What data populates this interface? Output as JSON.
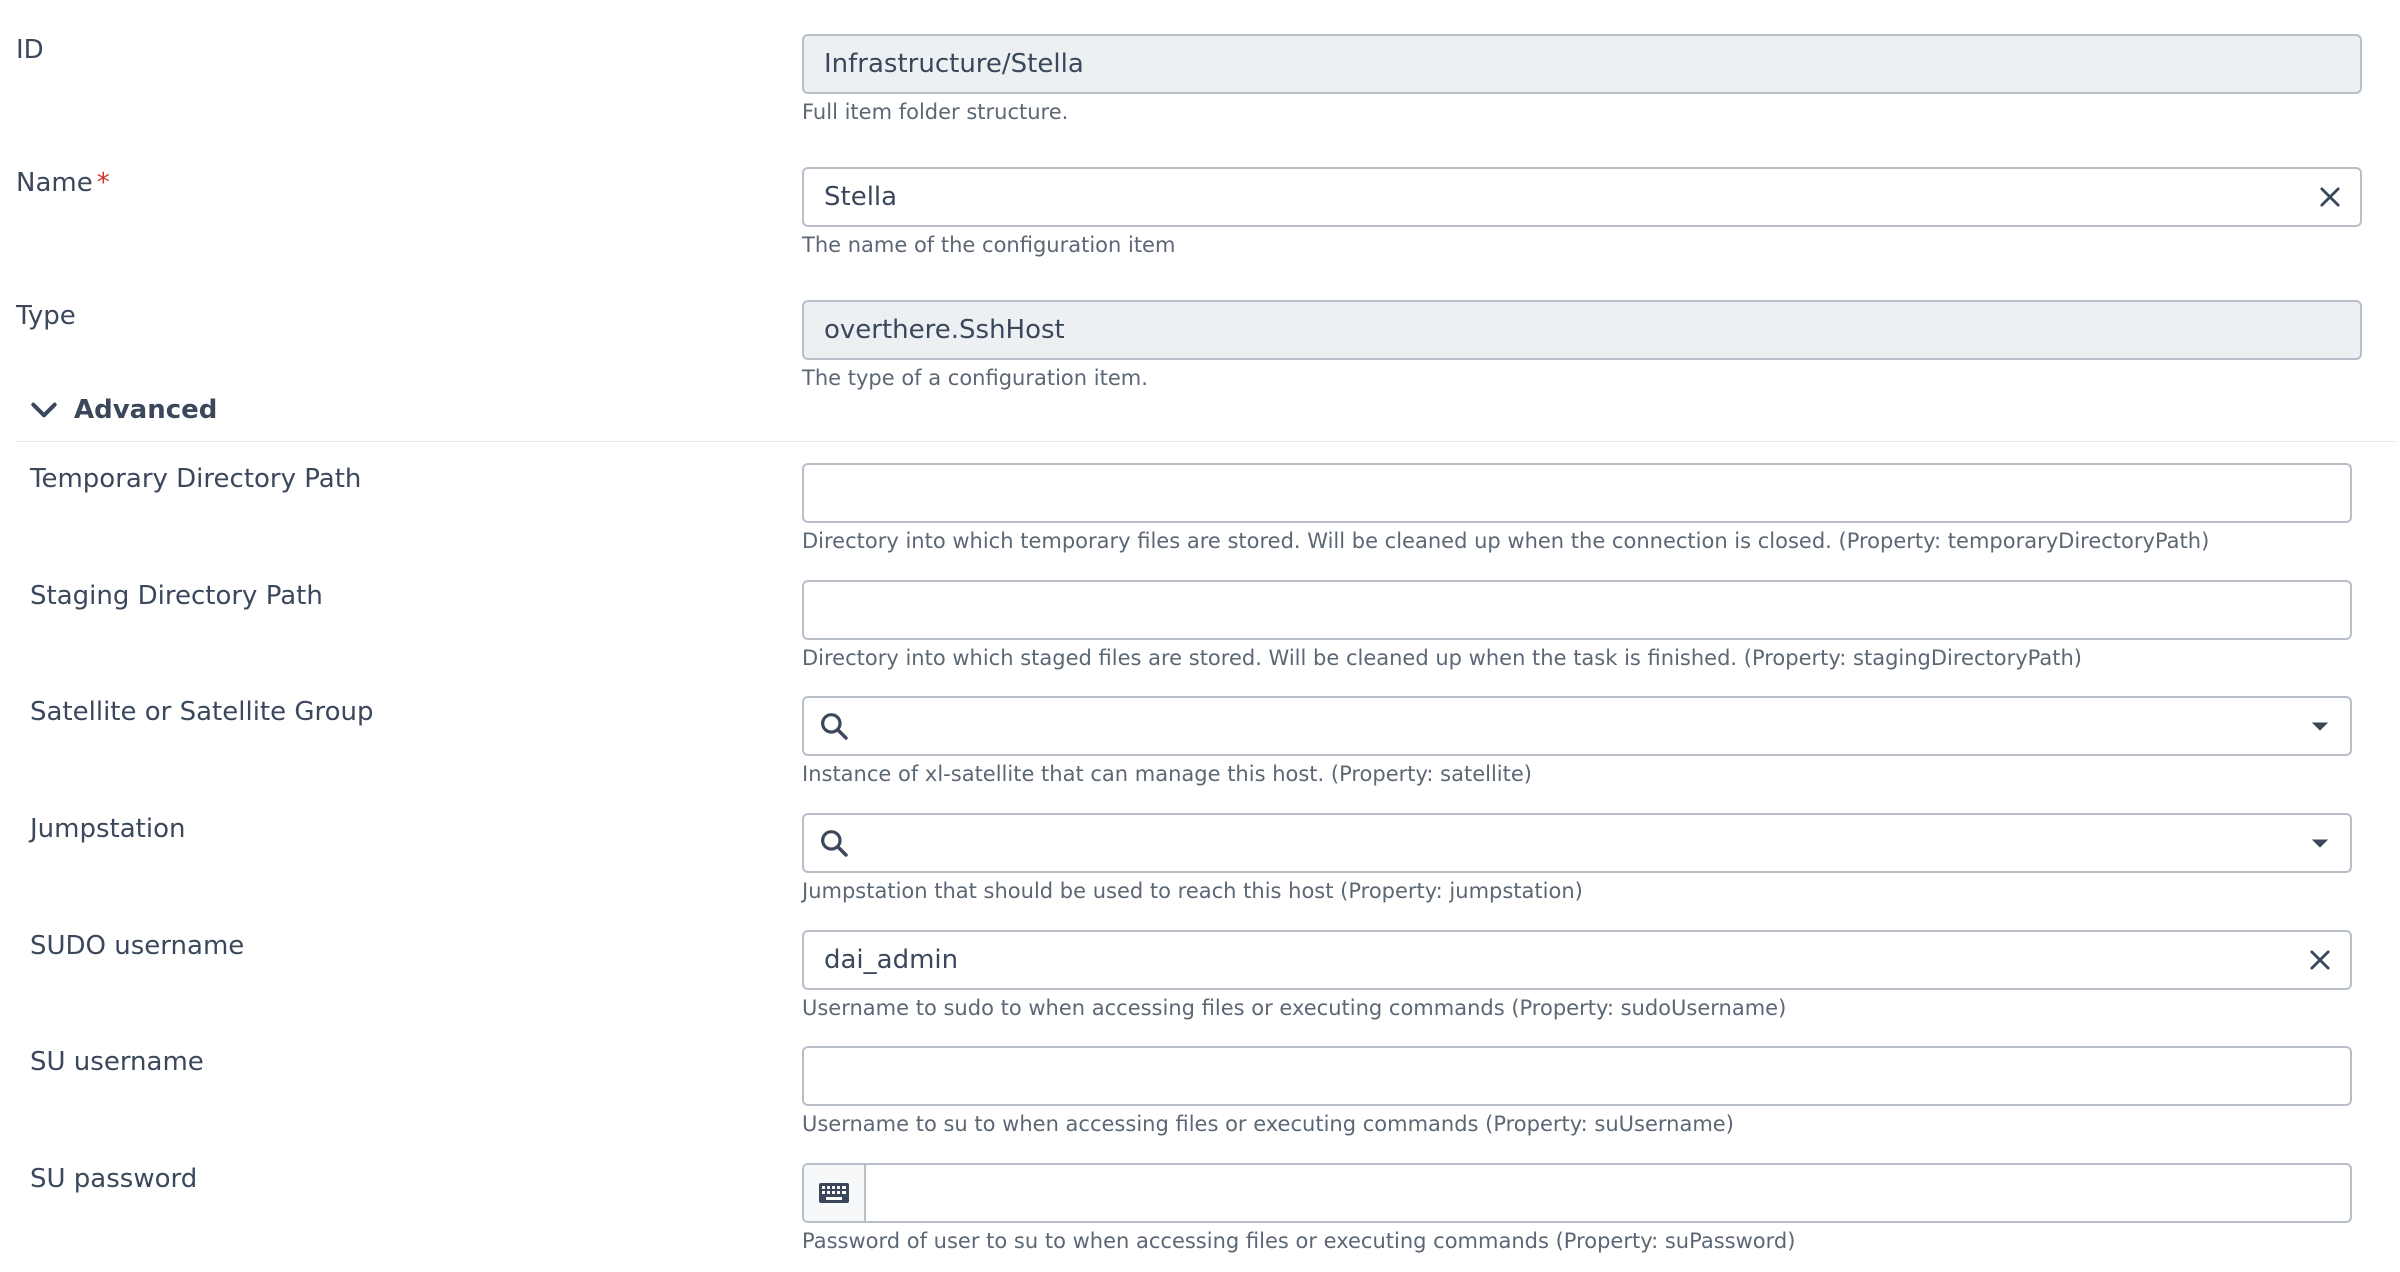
{
  "basic": {
    "id": {
      "label": "ID",
      "value": "Infrastructure/Stella",
      "helper": "Full item folder structure."
    },
    "name": {
      "label": "Name",
      "required_mark": "*",
      "value": "Stella",
      "helper": "The name of the configuration item"
    },
    "type": {
      "label": "Type",
      "value": "overthere.SshHost",
      "helper": "The type of a configuration item."
    }
  },
  "advanced": {
    "title": "Advanced",
    "expanded": true,
    "fields": {
      "temporary_directory_path": {
        "label": "Temporary Directory Path",
        "value": "",
        "helper": "Directory into which temporary files are stored. Will be cleaned up when the connection is closed. (Property: temporaryDirectoryPath)"
      },
      "staging_directory_path": {
        "label": "Staging Directory Path",
        "value": "",
        "helper": "Directory into which staged files are stored. Will be cleaned up when the task is finished. (Property: stagingDirectoryPath)"
      },
      "satellite": {
        "label": "Satellite or Satellite Group",
        "value": "",
        "helper": "Instance of xl-satellite that can manage this host. (Property: satellite)"
      },
      "jumpstation": {
        "label": "Jumpstation",
        "value": "",
        "helper": "Jumpstation that should be used to reach this host (Property: jumpstation)"
      },
      "sudo_username": {
        "label": "SUDO username",
        "value": "dai_admin",
        "helper": "Username to sudo to when accessing files or executing commands (Property: sudoUsername)"
      },
      "su_username": {
        "label": "SU username",
        "value": "",
        "helper": "Username to su to when accessing files or executing commands (Property: suUsername)"
      },
      "su_password": {
        "label": "SU password",
        "value": "",
        "helper": "Password of user to su to when accessing files or executing commands (Property: suPassword)"
      }
    }
  },
  "icons": {
    "clear": "close-icon",
    "search": "search-icon",
    "dropdown": "caret-down-icon",
    "section": "chevron-down-icon",
    "keyboard": "keyboard-icon"
  },
  "colors": {
    "text": "#3b485c",
    "helper_text": "#5c6775",
    "border": "#b8bfc9",
    "readonly_bg": "#edf0f3",
    "required": "#d0352b"
  }
}
